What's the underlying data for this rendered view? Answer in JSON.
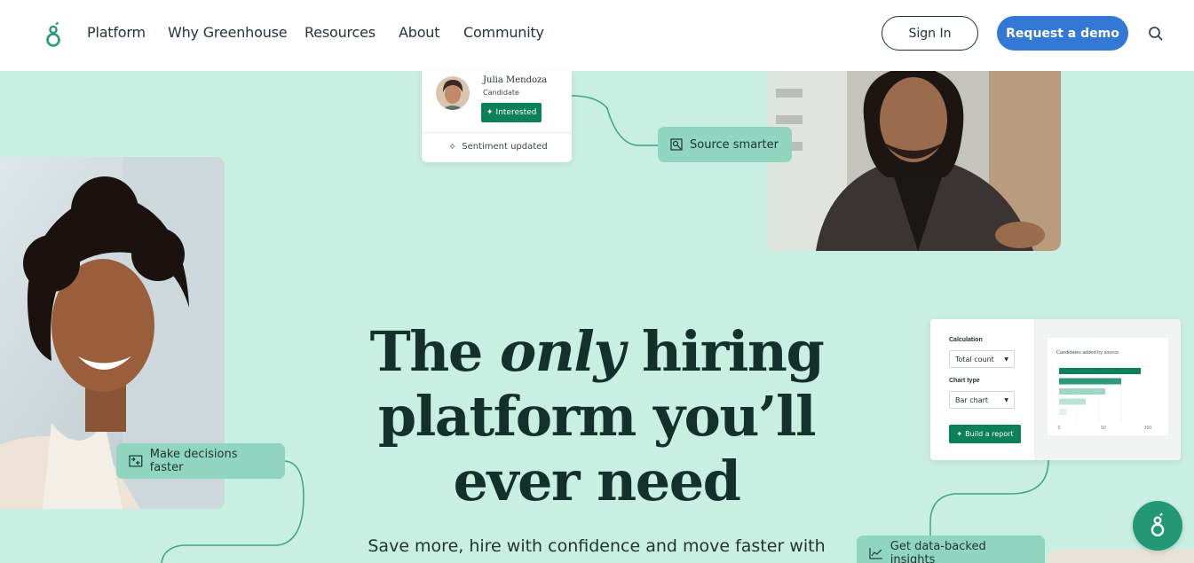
{
  "nav": {
    "logo_label": "Greenhouse",
    "links": [
      "Platform",
      "Why Greenhouse",
      "Resources",
      "About",
      "Community"
    ],
    "sign_in": "Sign In",
    "request_demo": "Request a demo"
  },
  "candidate_card": {
    "name": "Julia Mendoza",
    "role": "Candidate",
    "badge": "Interested",
    "sentiment": "Sentiment updated"
  },
  "pills": {
    "source": "Source smarter",
    "decisions": "Make decisions faster",
    "insights": "Get data-backed insights"
  },
  "report_card": {
    "calculation_label": "Calculation",
    "calculation_value": "Total count",
    "chart_type_label": "Chart type",
    "chart_type_value": "Bar chart",
    "build_button": "Build a report",
    "chart_title": "Candidates added by source",
    "axis_ticks": [
      "0",
      "50",
      "100"
    ],
    "bar_values": [
      92,
      70,
      52,
      30,
      8
    ]
  },
  "hero": {
    "title_pre": "The ",
    "title_em": "only",
    "title_post": " hiring platform you’ll ever need",
    "subtitle": "Save more, hire with confidence and move faster with"
  },
  "colors": {
    "background": "#c9eee2",
    "brand_green": "#0b8059",
    "pill_green": "#8fd5bf",
    "demo_blue": "#3478d6"
  }
}
